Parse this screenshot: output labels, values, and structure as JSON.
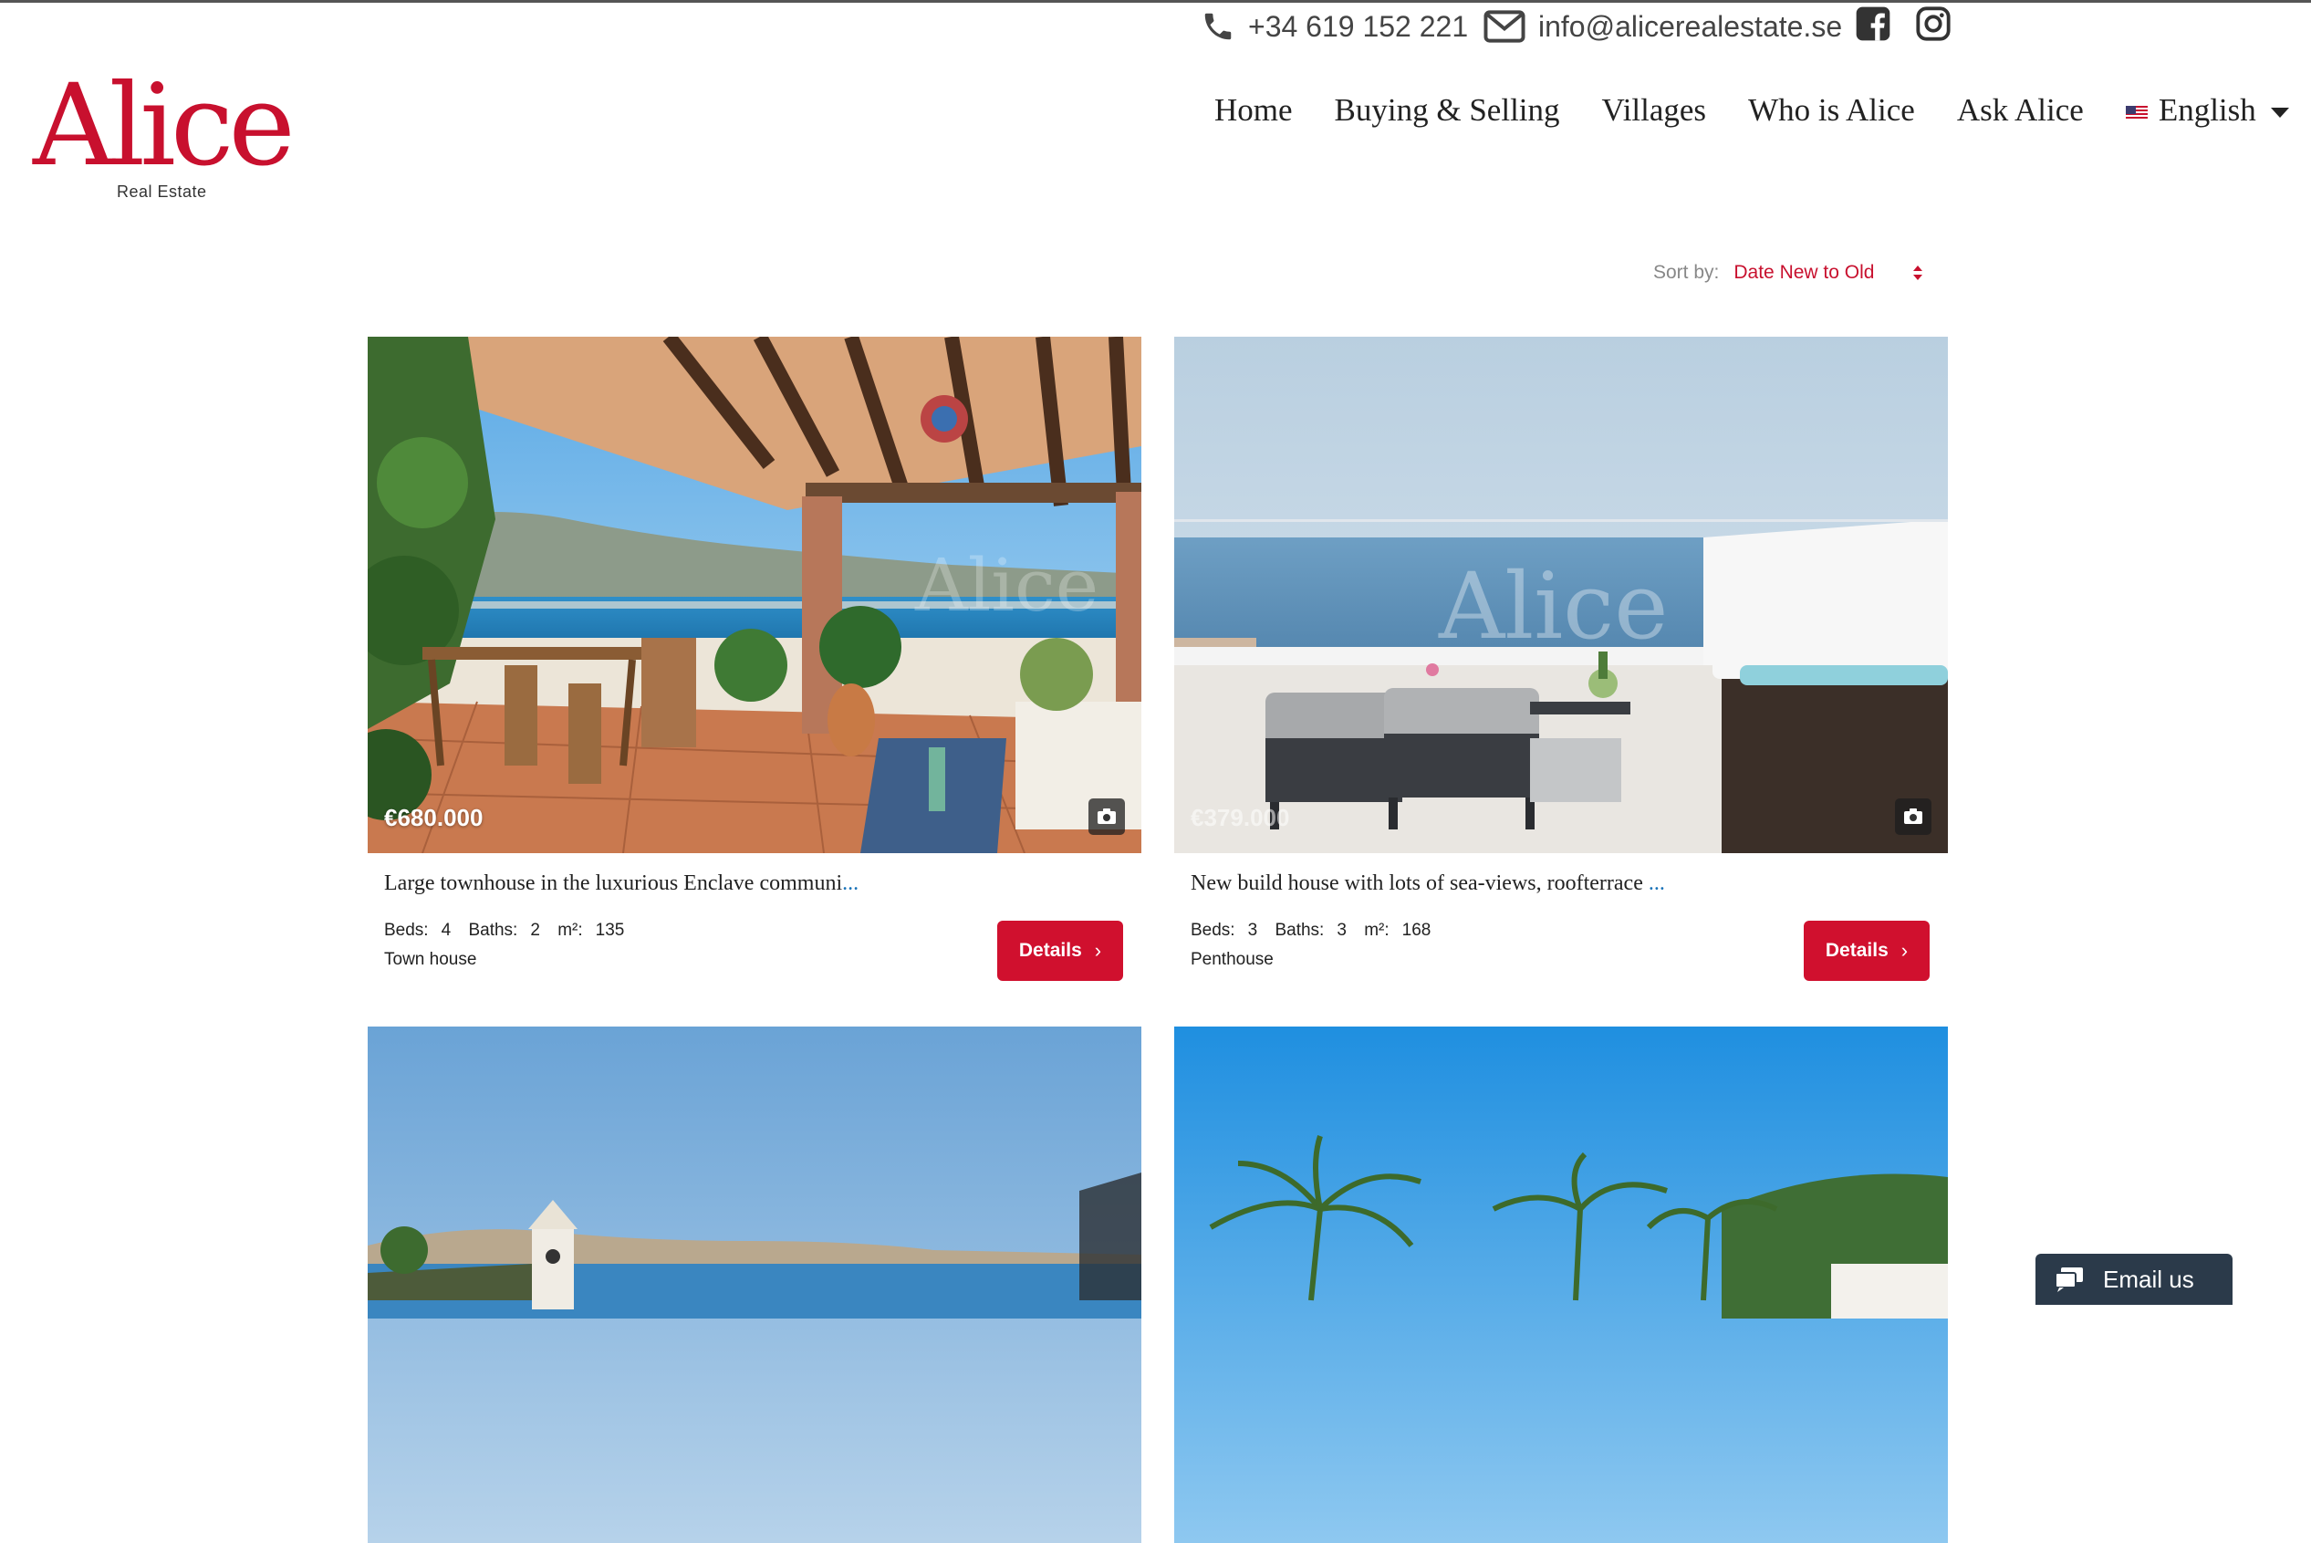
{
  "header": {
    "phone": "+34 619 152 221",
    "email": "info@alicerealestate.se",
    "social_icons": [
      "facebook-icon",
      "instagram-icon"
    ]
  },
  "logo": {
    "word": "Alice",
    "sub": "Real Estate",
    "color": "#c8102e"
  },
  "nav": {
    "items": [
      "Home",
      "Buying & Selling",
      "Villages",
      "Who is Alice",
      "Ask Alice"
    ],
    "language": "English"
  },
  "sort": {
    "label": "Sort by:",
    "value": "Date New to Old"
  },
  "listings": [
    {
      "price": "€680.000",
      "title": "Large townhouse in the luxurious Enclave communi",
      "ellipsis": "...",
      "beds_label": "Beds:",
      "beds": "4",
      "baths_label": "Baths:",
      "baths": "2",
      "area_label": "m²:",
      "area": "135",
      "type": "Town house",
      "button": "Details"
    },
    {
      "price": "€379.000",
      "title": "New build house with lots of sea-views, roofterrace ",
      "ellipsis": "...",
      "beds_label": "Beds:",
      "beds": "3",
      "baths_label": "Baths:",
      "baths": "3",
      "area_label": "m²:",
      "area": "168",
      "type": "Penthouse",
      "button": "Details"
    }
  ],
  "email_widget": {
    "label": "Email us"
  },
  "colors": {
    "accent": "#c8102e",
    "button": "#d0102e",
    "link": "#1a73b8",
    "widget": "#2b3a4a"
  }
}
